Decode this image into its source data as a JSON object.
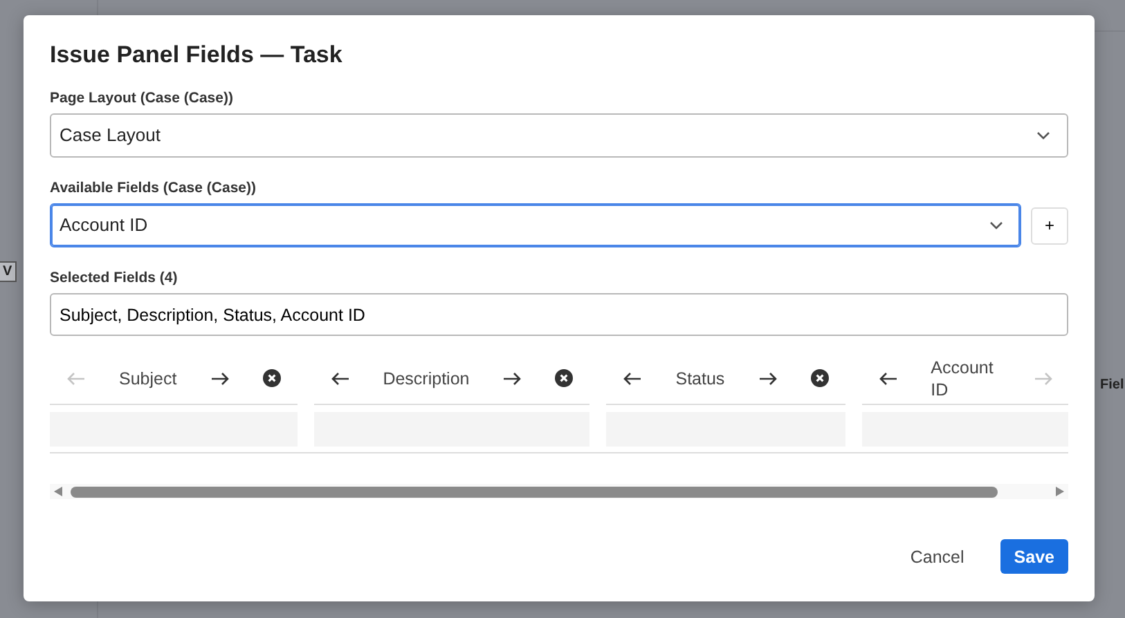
{
  "background": {
    "fragments": [
      {
        "text": "V",
        "kind": "key"
      },
      {
        "text": "Fiel",
        "kind": "label"
      }
    ]
  },
  "dialog": {
    "title": "Issue Panel Fields — Task",
    "page_layout": {
      "label": "Page Layout (Case (Case))",
      "value": "Case Layout",
      "focused": false
    },
    "available_fields": {
      "label": "Available Fields (Case (Case))",
      "value": "Account ID",
      "focused": true,
      "add_button": "+"
    },
    "selected_fields": {
      "label": "Selected Fields (4)",
      "value": "Subject, Description, Status, Account ID"
    },
    "columns": [
      {
        "label": "Subject",
        "left_enabled": false,
        "right_enabled": true,
        "remove_icon": true
      },
      {
        "label": "Description",
        "left_enabled": true,
        "right_enabled": true,
        "remove_icon": true
      },
      {
        "label": "Status",
        "left_enabled": true,
        "right_enabled": true,
        "remove_icon": true
      },
      {
        "label": "Account ID",
        "left_enabled": true,
        "right_enabled": false,
        "remove_icon": false
      }
    ],
    "buttons": [
      {
        "label": "Cancel",
        "kind": "secondary"
      },
      {
        "label": "Save",
        "kind": "primary"
      }
    ]
  }
}
